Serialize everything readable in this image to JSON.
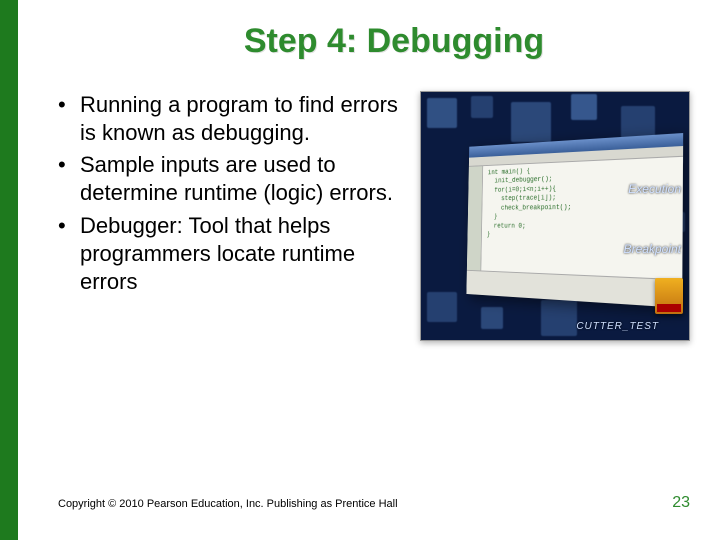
{
  "title": "Step 4: Debugging",
  "bullets": [
    "Running a program to find errors is known as debugging.",
    "Sample inputs are used to determine runtime (logic) errors.",
    "Debugger: Tool that helps programmers locate runtime errors"
  ],
  "decorative": {
    "label1": "Execution",
    "label2": "Breakpoint",
    "label3": "CUTTER_TEST"
  },
  "footer": "Copyright © 2010 Pearson Education, Inc. Publishing as Prentice Hall",
  "page_number": "23"
}
